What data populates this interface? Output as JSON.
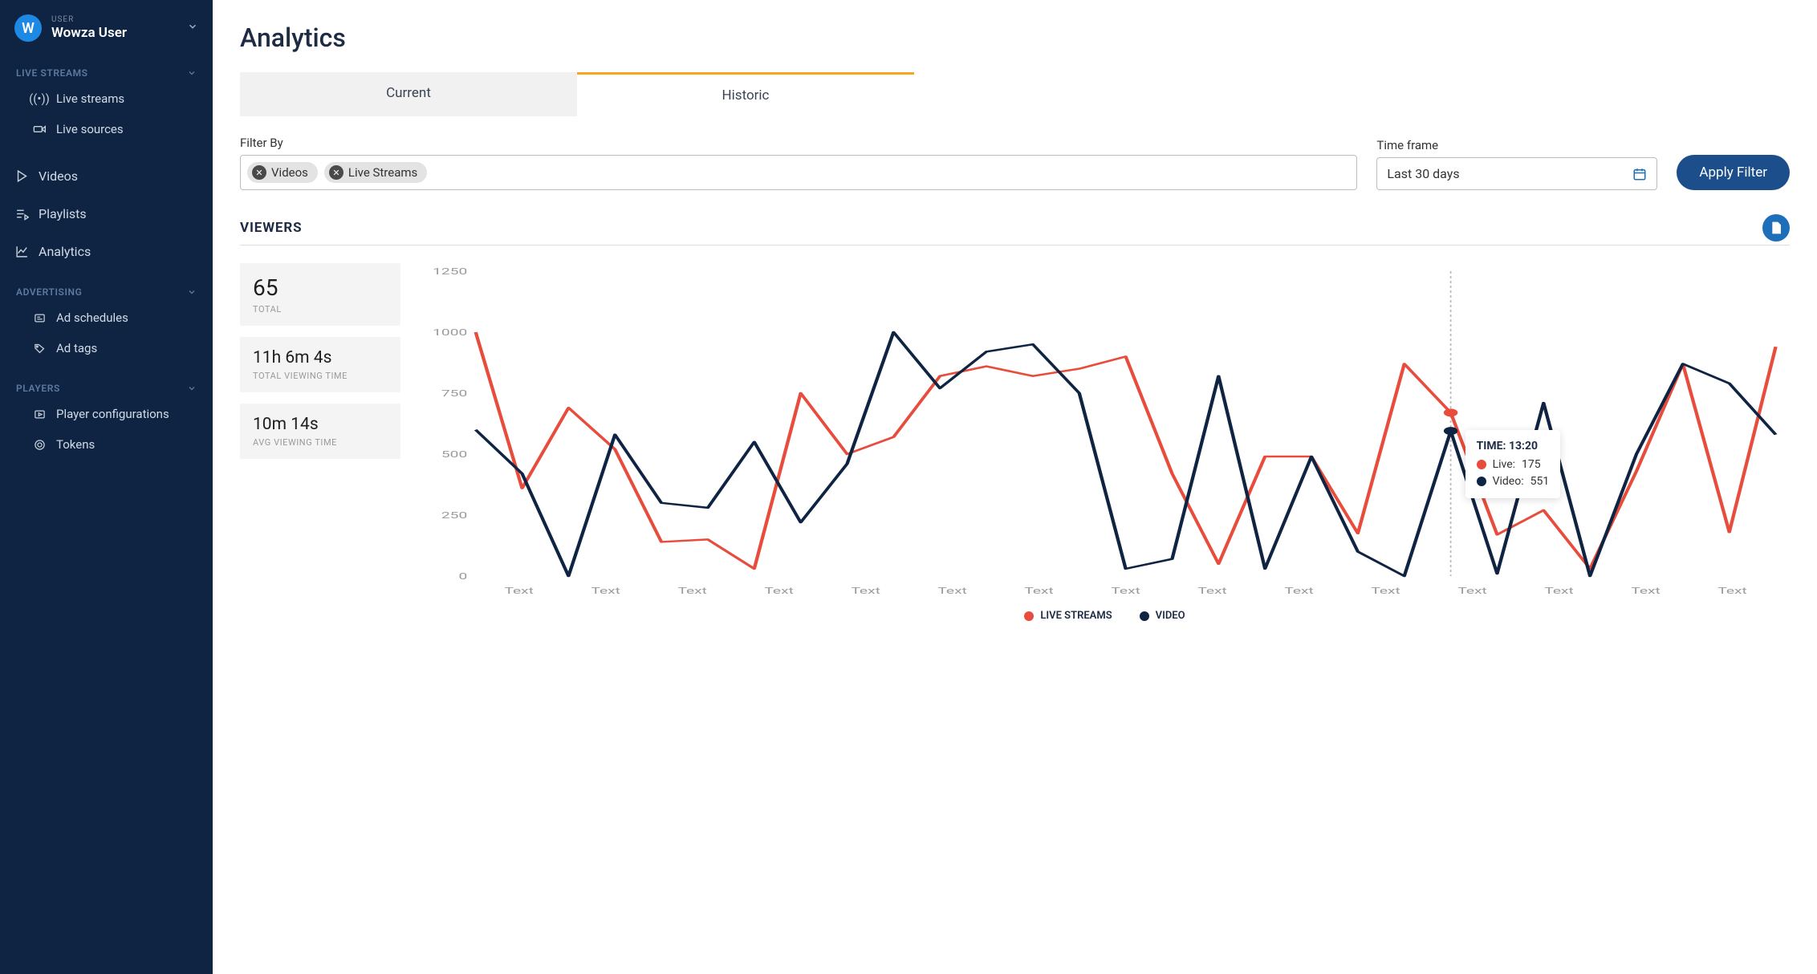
{
  "user": {
    "label": "USER",
    "name": "Wowza User",
    "avatar": "W"
  },
  "sidebar": {
    "sections": [
      {
        "title": "LIVE STREAMS",
        "items": [
          {
            "icon": "broadcast-icon",
            "label": "Live streams"
          },
          {
            "icon": "camera-icon",
            "label": "Live sources"
          }
        ]
      },
      {
        "title": null,
        "items": [
          {
            "icon": "play-icon",
            "label": "Videos"
          },
          {
            "icon": "playlist-icon",
            "label": "Playlists"
          },
          {
            "icon": "chart-icon",
            "label": "Analytics"
          }
        ]
      },
      {
        "title": "ADVERTISING",
        "items": [
          {
            "icon": "schedule-icon",
            "label": "Ad schedules"
          },
          {
            "icon": "tag-icon",
            "label": "Ad tags"
          }
        ]
      },
      {
        "title": "PLAYERS",
        "items": [
          {
            "icon": "config-icon",
            "label": "Player configurations"
          },
          {
            "icon": "token-icon",
            "label": "Tokens"
          }
        ]
      }
    ]
  },
  "page": {
    "title": "Analytics",
    "tabs": {
      "current": "Current",
      "historic": "Historic",
      "active": "historic"
    },
    "filter": {
      "label": "Filter By",
      "chips": [
        "Videos",
        "Live Streams"
      ]
    },
    "timeframe": {
      "label": "Time frame",
      "value": "Last 30 days"
    },
    "apply": "Apply Filter",
    "viewers_section": "VIEWERS",
    "stats": [
      {
        "value": "65",
        "label": "TOTAL",
        "size": "big"
      },
      {
        "value": "11h 6m 4s",
        "label": "TOTAL VIEWING TIME",
        "size": "mid"
      },
      {
        "value": "10m 14s",
        "label": "AVG VIEWING TIME",
        "size": "mid"
      }
    ],
    "legend": {
      "live": "LIVE STREAMS",
      "video": "VIDEO"
    },
    "tooltip": {
      "time_label": "TIME:",
      "time_value": "13:20",
      "live_label": "Live:",
      "live_value": "175",
      "video_label": "Video:",
      "video_value": "551"
    }
  },
  "chart_data": {
    "type": "line",
    "ylim": [
      0,
      1250
    ],
    "yticks": [
      0,
      250,
      500,
      750,
      1000,
      1250
    ],
    "x_tick_label": "Text",
    "x_tick_count": 15,
    "series": [
      {
        "name": "LIVE STREAMS",
        "color": "#e74c3c",
        "values": [
          1000,
          360,
          690,
          520,
          140,
          150,
          30,
          750,
          500,
          570,
          820,
          860,
          820,
          850,
          900,
          420,
          50,
          490,
          490,
          175,
          870,
          670,
          170,
          270,
          30,
          430,
          870,
          180,
          940
        ]
      },
      {
        "name": "VIDEO",
        "color": "#0f2442",
        "values": [
          600,
          420,
          0,
          580,
          300,
          280,
          550,
          220,
          460,
          1000,
          770,
          920,
          950,
          750,
          30,
          70,
          820,
          30,
          490,
          100,
          0,
          595,
          10,
          710,
          0,
          500,
          870,
          790,
          580
        ]
      }
    ],
    "tooltip_index": 21,
    "tooltip": {
      "time": "13:20",
      "live": 175,
      "video": 551
    }
  }
}
